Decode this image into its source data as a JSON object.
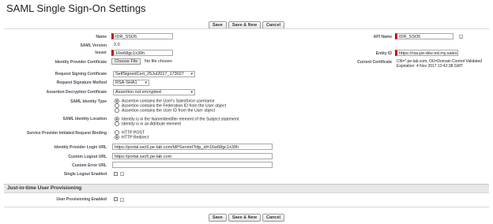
{
  "page": {
    "title": "SAML Single Sign-On Settings"
  },
  "buttons": {
    "save": "Save",
    "save_new": "Save & New",
    "cancel": "Cancel"
  },
  "fields": {
    "name": {
      "label": "Name",
      "value": "IDR_SSO5"
    },
    "saml_version": {
      "label": "SAML Version",
      "value": "2.0"
    },
    "issuer": {
      "label": "Issuer",
      "value": "16w68gc1x39h"
    },
    "idp_certificate": {
      "label": "Identity Provider Certificate",
      "button": "Choose File",
      "status": "No file chosen"
    },
    "request_signing_cert": {
      "label": "Request Signing Certificate",
      "value": "SelfSignedCert_25Jul2017_173027"
    },
    "request_signature_method": {
      "label": "Request Signature Method",
      "value": "RSA-SHA1"
    },
    "assertion_decryption_cert": {
      "label": "Assertion Decryption Certificate",
      "value": "Assertion not encrypted"
    },
    "saml_identity_type": {
      "label": "SAML Identity Type",
      "options": [
        {
          "text": "Assertion contains the User's Salesforce username",
          "selected": true
        },
        {
          "text": "Assertion contains the Federation ID from the User object",
          "selected": false
        },
        {
          "text": "Assertion contains the User ID from the User object",
          "selected": false
        }
      ]
    },
    "saml_identity_location": {
      "label": "SAML Identity Location",
      "options": [
        {
          "text": "Identity is in the NameIdentifier element of the Subject statement",
          "selected": true
        },
        {
          "text": "Identity is in an Attribute element",
          "selected": false
        }
      ]
    },
    "sp_request_binding": {
      "label": "Service Provider Initiated Request Binding",
      "options": [
        {
          "text": "HTTP POST",
          "selected": false
        },
        {
          "text": "HTTP Redirect",
          "selected": true
        }
      ]
    },
    "idp_login_url": {
      "label": "Identity Provider Login URL",
      "value": "https://portal.sso5.pe-lab.com/IdPServlet?idp_id=16w68gc1x39h"
    },
    "custom_logout_url": {
      "label": "Custom Logout URL",
      "value": "https://portal.sso5.pe-lab.com"
    },
    "custom_error_url": {
      "label": "Custom Error URL",
      "value": ""
    },
    "single_logout_enabled": {
      "label": "Single Logout Enabled",
      "checked": false
    },
    "api_name": {
      "label": "API Name",
      "value": "IDR_SSO5"
    },
    "entity_id": {
      "label": "Entity ID",
      "value": "https://rsa-pe-dev-ed.my.sales"
    },
    "current_certificate": {
      "label": "Current Certificate",
      "line1": "CN=*.pe-lab.com, OU=Domain Control Validated",
      "line2": "Expiration: 4 Nov 2017 13:42:38 GMT"
    }
  },
  "jit_section": {
    "title": "Just-in-time User Provisioning",
    "user_provisioning": {
      "label": "User Provisioning Enabled",
      "checked": false
    }
  },
  "icons": {
    "info": "i"
  }
}
